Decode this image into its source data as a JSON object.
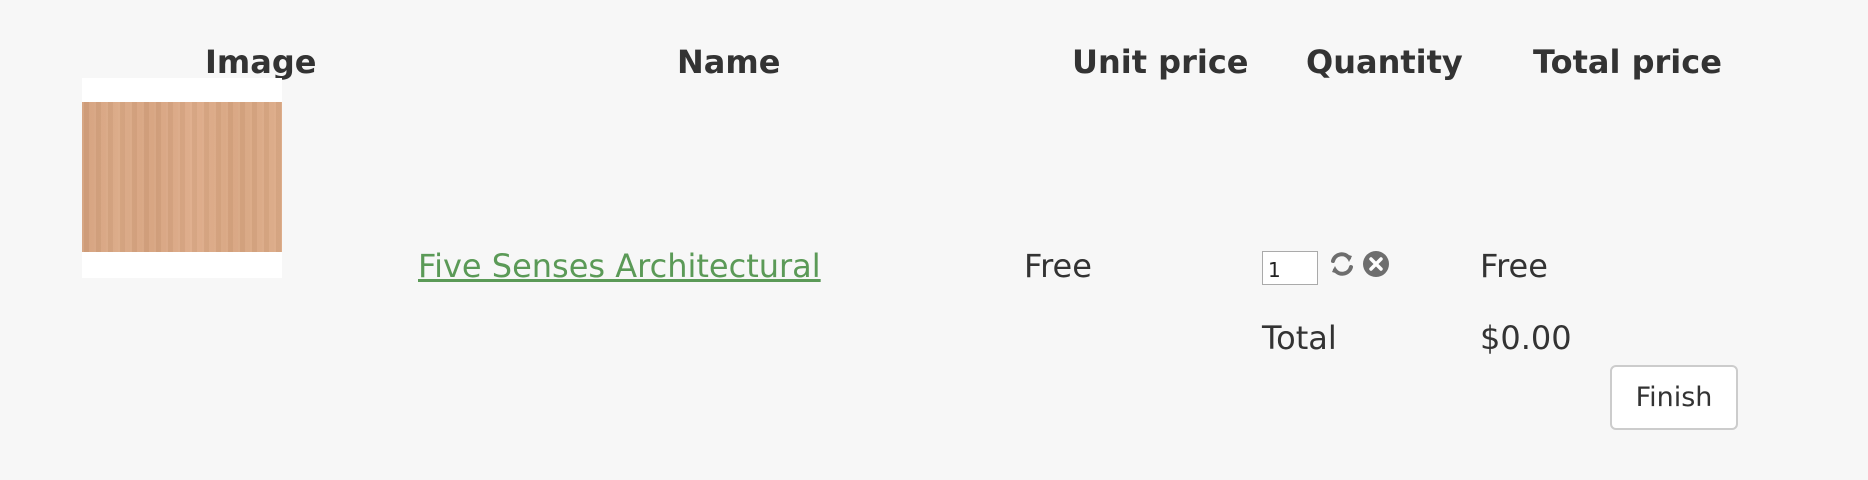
{
  "table": {
    "headers": {
      "image": "Image",
      "name": "Name",
      "unit_price": "Unit price",
      "quantity": "Quantity",
      "total_price": "Total price"
    },
    "rows": [
      {
        "name": "Five Senses Architectural",
        "unit_price": "Free",
        "quantity": "1",
        "total_price": "Free",
        "image": "wood-texture-thumbnail"
      }
    ]
  },
  "summary": {
    "total_label": "Total",
    "total_value": "$0.00"
  },
  "actions": {
    "finish_label": "Finish",
    "refresh_icon": "refresh-icon",
    "remove_icon": "remove-icon"
  },
  "colors": {
    "link": "#5b9a57",
    "background": "#f7f7f7",
    "text": "#333333"
  }
}
